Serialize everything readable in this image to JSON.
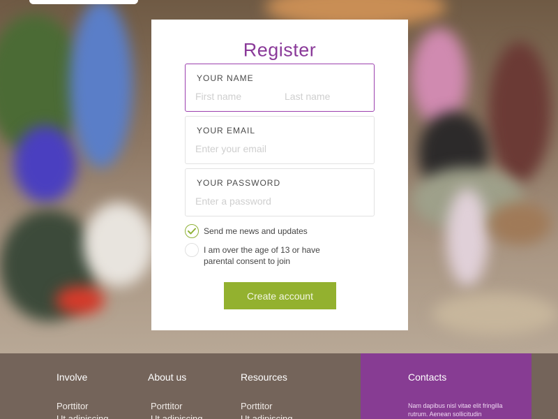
{
  "register": {
    "title": "Register",
    "name_field": {
      "label": "YOUR NAME",
      "first_placeholder": "First name",
      "last_placeholder": "Last name"
    },
    "email_field": {
      "label": "YOUR EMAIL",
      "placeholder": "Enter your email"
    },
    "password_field": {
      "label": "YOUR PASSWORD",
      "placeholder": "Enter a password"
    },
    "checkboxes": [
      {
        "label": "Send me news and updates",
        "checked": true
      },
      {
        "label": "I am over the age of 13 or have parental consent to join",
        "checked": false
      }
    ],
    "submit_label": "Create account"
  },
  "footer": {
    "columns": [
      {
        "heading": "Involve",
        "link": "Porttitor",
        "link2": "Ut adipiscing"
      },
      {
        "heading": "About us",
        "link": "Porttitor",
        "link2": "Ut adipiscing"
      },
      {
        "heading": "Resources",
        "link": "Porttitor",
        "link2": "Ut adipiscing"
      }
    ],
    "contacts": {
      "heading": "Contacts",
      "text": "Nam dapibus nisl vitae elit fringilla rutrum. Aenean sollicitudin"
    }
  },
  "colors": {
    "accent_purple": "#8a3a99",
    "button_green": "#93b12f",
    "footer_brown": "#74645a",
    "contacts_purple": "#873c93"
  }
}
